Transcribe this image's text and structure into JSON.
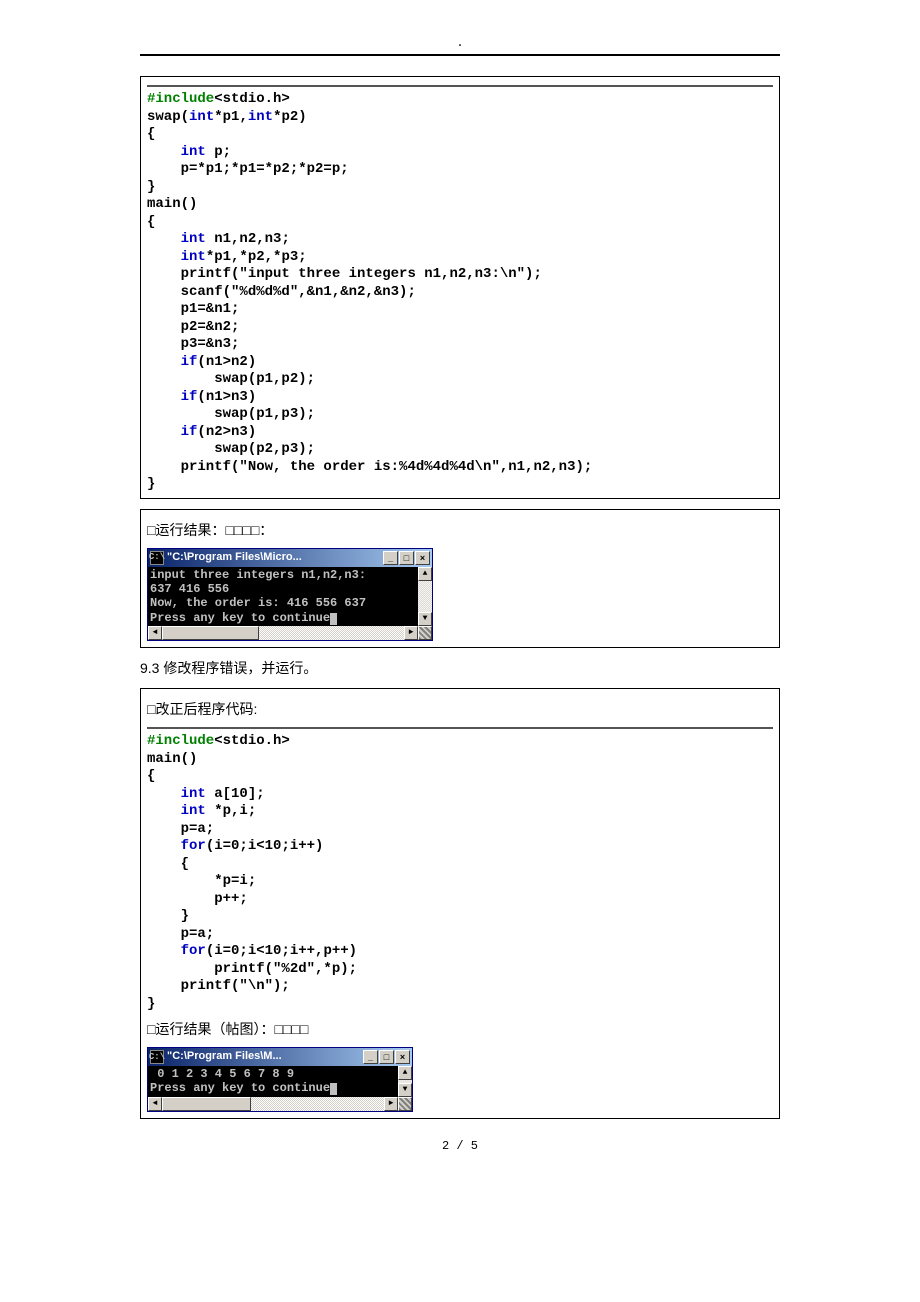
{
  "header_dot": ".",
  "code1": {
    "l01a": "#include",
    "l01b": "<stdio.h>",
    "l02a": "swap(",
    "l02b": "int",
    "l02c": "*p1,",
    "l02d": "int",
    "l02e": "*p2)",
    "l03": "{",
    "l04a": "    ",
    "l04b": "int",
    "l04c": " p;",
    "l05": "    p=*p1;*p1=*p2;*p2=p;",
    "l06": "}",
    "l07": "main()",
    "l08": "{",
    "l09a": "    ",
    "l09b": "int",
    "l09c": " n1,n2,n3;",
    "l10a": "    ",
    "l10b": "int",
    "l10c": "*p1,*p2,*p3;",
    "l11": "    printf(\"input three integers n1,n2,n3:\\n\");",
    "l12": "    scanf(\"%d%d%d\",&n1,&n2,&n3);",
    "l13": "    p1=&n1;",
    "l14": "    p2=&n2;",
    "l15": "    p3=&n3;",
    "l16a": "    ",
    "l16b": "if",
    "l16c": "(n1>n2)",
    "l17": "        swap(p1,p2);",
    "l18a": "    ",
    "l18b": "if",
    "l18c": "(n1>n3)",
    "l19": "        swap(p1,p3);",
    "l20a": "    ",
    "l20b": "if",
    "l20c": "(n2>n3)",
    "l21": "        swap(p2,p3);",
    "l22": "    printf(\"Now, the order is:%4d%4d%4d\\n\",n1,n2,n3);",
    "l23": "}"
  },
  "result_label1": "□运行结果：□□□□：",
  "console1": {
    "icon": "C:\\",
    "title": "\"C:\\Program Files\\Micro...",
    "body_line1": "input three integers n1,n2,n3:",
    "body_line2": "637 416 556",
    "body_line3": "Now, the order is: 416 556 637",
    "body_line4": "Press any key to continue"
  },
  "section_93": "9.3 修改程序错误，并运行。",
  "fix_label": "□改正后程序代码:",
  "code2": {
    "l01a": "#include",
    "l01b": "<stdio.h>",
    "l02": "main()",
    "l03": "{",
    "l04a": "    ",
    "l04b": "int",
    "l04c": " a[10];",
    "l05a": "    ",
    "l05b": "int",
    "l05c": " *p,i;",
    "l06": "    p=a;",
    "l07a": "    ",
    "l07b": "for",
    "l07c": "(i=0;i<10;i++)",
    "l08": "    {",
    "l09": "        *p=i;",
    "l10": "        p++;",
    "l11": "    }",
    "l12": "    p=a;",
    "l13a": "    ",
    "l13b": "for",
    "l13c": "(i=0;i<10;i++,p++)",
    "l14": "        printf(\"%2d\",*p);",
    "l15": "    printf(\"\\n\");",
    "l16": "}"
  },
  "result_label2": " □运行结果（帖图）：□□□□",
  "console2": {
    "icon": "C:\\",
    "title": "\"C:\\Program Files\\M...",
    "body_line1": " 0 1 2 3 4 5 6 7 8 9",
    "body_line2": "Press any key to continue"
  },
  "page_num": "2 / 5",
  "win_ctrl": {
    "min": "_",
    "max": "□",
    "close": "×",
    "up": "▲",
    "down": "▼",
    "left": "◄",
    "right": "►"
  }
}
